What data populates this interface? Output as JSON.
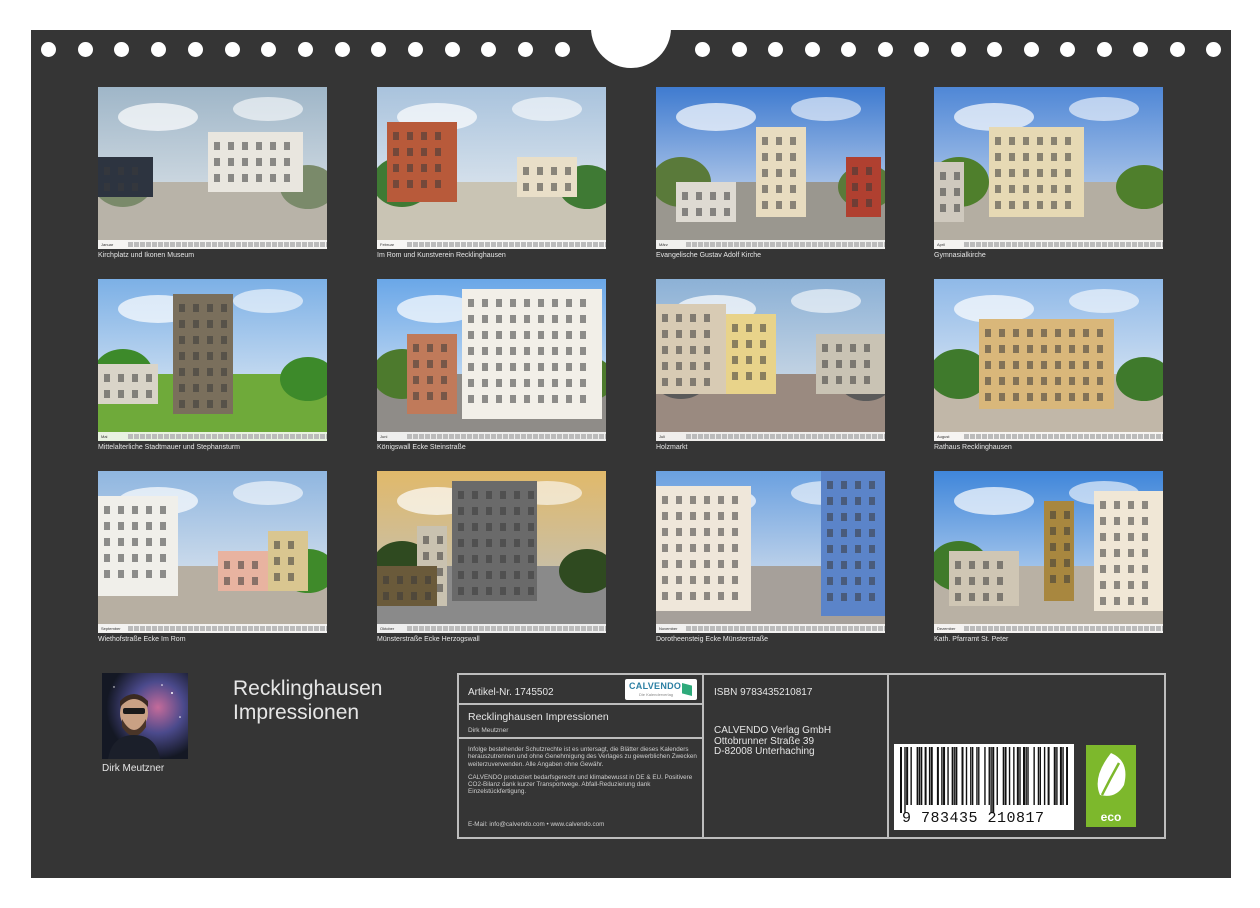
{
  "months": [
    {
      "caption": "Kirchplatz und Ikonen Museum",
      "month": "Januar"
    },
    {
      "caption": "Im Rom und Kunstverein Recklinghausen",
      "month": "Februar"
    },
    {
      "caption": "Evangelische Gustav Adolf Kirche",
      "month": "März"
    },
    {
      "caption": "Gymnasialkirche",
      "month": "April"
    },
    {
      "caption": "Mittelalterliche Stadtmauer und Stephansturm",
      "month": "Mai"
    },
    {
      "caption": "Königswall Ecke Steinstraße",
      "month": "Juni"
    },
    {
      "caption": "Holzmarkt",
      "month": "Juli"
    },
    {
      "caption": "Rathaus Recklinghausen",
      "month": "August"
    },
    {
      "caption": "Wiethofstraße Ecke Im Rom",
      "month": "September"
    },
    {
      "caption": "Münsterstraße Ecke Herzogswall",
      "month": "Oktober"
    },
    {
      "caption": "Dorotheensteig Ecke Münsterstraße",
      "month": "November"
    },
    {
      "caption": "Kath. Pfarramt St. Peter",
      "month": "Dezember"
    }
  ],
  "author": {
    "name": "Dirk Meutzner"
  },
  "title": {
    "line1": "Recklinghausen",
    "line2": "Impressionen"
  },
  "info": {
    "article": "Artikel-Nr. 1745502",
    "logo_text": "CALVENDO",
    "logo_sub": "Die Kalenderverlag",
    "calendar_title": "Recklinghausen Impressionen",
    "calendar_author": "Dirk Meutzner",
    "legal_1": "Infolge bestehender Schutzrechte ist es untersagt, die Blätter dieses Kalenders herauszutrennen und ohne Genehmigung des Verlages zu gewerblichen Zwecken weiterzuverwenden. Alle Angaben ohne Gewähr.",
    "legal_2": "CALVENDO produziert bedarfsgerecht und klimabewusst in DE & EU. Positivere CO2-Bilanz dank kurzer Transportwege. Abfall-Reduzierung dank Einzelstückfertigung.",
    "email": "E-Mail: info@calvendo.com • www.calvendo.com",
    "isbn": "ISBN 9783435210817",
    "publisher_1": "CALVENDO Verlag GmbH",
    "publisher_2": "Ottobrunner Straße 39",
    "publisher_3": "D-82008 Unterhaching",
    "barcode_number": "9  783435  210817",
    "eco_label": "eco"
  }
}
